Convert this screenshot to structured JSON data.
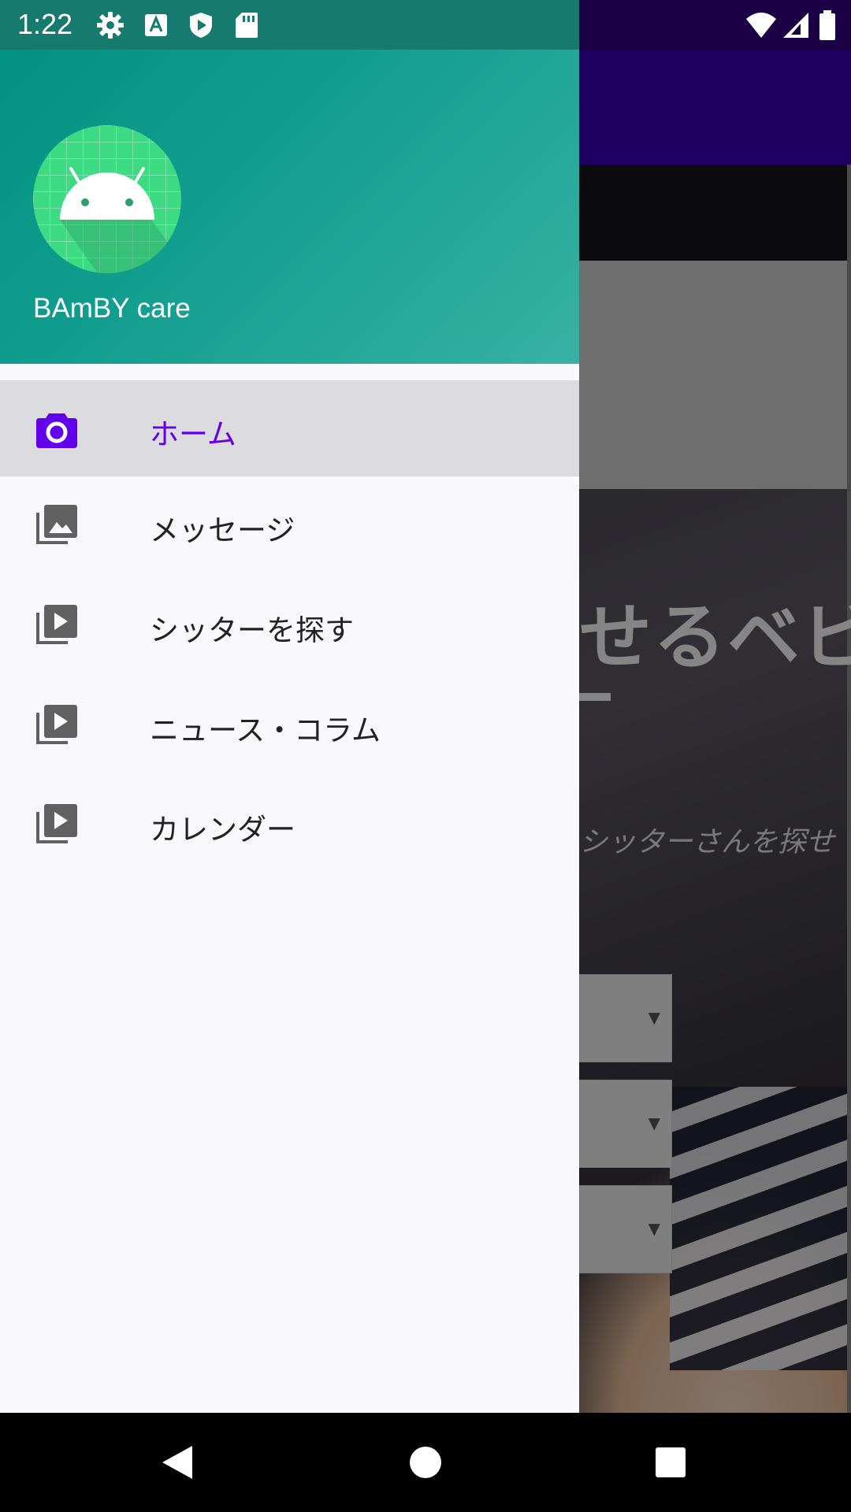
{
  "status_bar": {
    "time": "1:22",
    "left_icons": [
      "settings-icon",
      "keyboard-a-icon",
      "shield-play-icon",
      "sd-card-icon"
    ],
    "right_icons": [
      "wifi-icon",
      "cell-signal-icon",
      "battery-icon"
    ]
  },
  "drawer": {
    "app_name": "BAmBY care",
    "header_colors": {
      "start": "#00907f",
      "end": "#38b1a3"
    },
    "accent_color": "#6200ee",
    "items": [
      {
        "label": "ホーム",
        "icon": "camera-icon",
        "selected": true
      },
      {
        "label": "メッセージ",
        "icon": "gallery-icon",
        "selected": false
      },
      {
        "label": "シッターを探す",
        "icon": "video-library-icon",
        "selected": false
      },
      {
        "label": "ニュース・コラム",
        "icon": "video-library-icon",
        "selected": false
      },
      {
        "label": "カレンダー",
        "icon": "video-library-icon",
        "selected": false
      }
    ]
  },
  "background": {
    "headline": "せるベビ",
    "subtitle": "シッターさんを探せ"
  },
  "nav_bar": {
    "buttons": [
      "back-icon",
      "home-icon",
      "recents-icon"
    ]
  }
}
